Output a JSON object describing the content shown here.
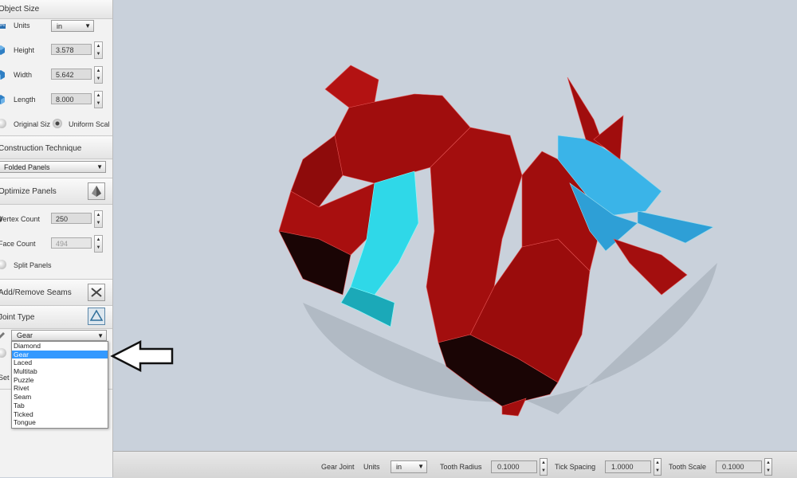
{
  "object_size": {
    "title": "Object Size",
    "units_label": "Units",
    "units_value": "in",
    "height_label": "Height",
    "height_value": "3.578",
    "width_label": "Width",
    "width_value": "5.642",
    "length_label": "Length",
    "length_value": "8.000",
    "original_size_label": "Original Siz",
    "uniform_scale_label": "Uniform Scal"
  },
  "construction": {
    "title": "Construction Technique",
    "value": "Folded Panels"
  },
  "optimize": {
    "title": "Optimize Panels",
    "vertex_label": "Vertex Count",
    "vertex_value": "250",
    "face_label": "Face Count",
    "face_value": "494",
    "split_label": "Split Panels"
  },
  "seams": {
    "title": "Add/Remove Seams"
  },
  "joint": {
    "title": "Joint Type",
    "value": "Gear",
    "hidden_label": "Set F",
    "options": [
      "Diamond",
      "Gear",
      "Laced",
      "Multitab",
      "Puzzle",
      "Rivet",
      "Seam",
      "Tab",
      "Ticked",
      "Tongue"
    ],
    "selected_index": 1
  },
  "bottom": {
    "gear_joint_label": "Gear Joint",
    "units_label": "Units",
    "units_value": "in",
    "tooth_radius_label": "Tooth Radius",
    "tooth_radius_value": "0.1000",
    "tick_spacing_label": "Tick Spacing",
    "tick_spacing_value": "1.0000",
    "tooth_scale_label": "Tooth Scale",
    "tooth_scale_value": "0.1000"
  },
  "colors": {
    "model_red": "#a50f0f",
    "model_dark": "#1a0505",
    "model_cyan": "#2fd8e8",
    "model_blue": "#3ab4e8",
    "viewport_bg": "#c9d1db",
    "selection_blue": "#3399ff"
  },
  "icons": {
    "arrow": "left-arrow-outline",
    "optimize": "pyramid-icon",
    "seams": "scissors-icon",
    "joint": "triangle-recycle-icon"
  }
}
